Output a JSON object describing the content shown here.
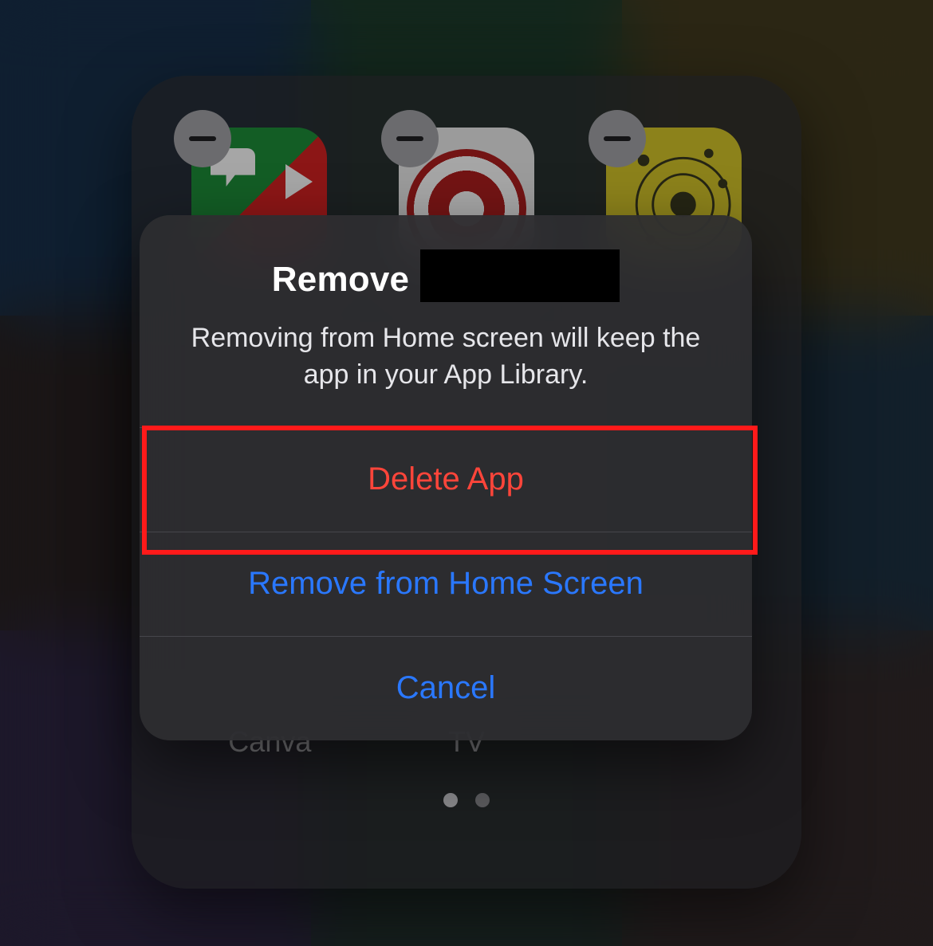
{
  "folder": {
    "labels": [
      "Canva",
      "TV",
      ""
    ],
    "page_dots": {
      "count": 2,
      "active_index": 0
    }
  },
  "alert": {
    "title_prefix": "Remove",
    "subtitle": "Removing from Home screen will keep the app in your App Library.",
    "buttons": {
      "delete": "Delete App",
      "remove": "Remove from Home Screen",
      "cancel": "Cancel"
    }
  }
}
